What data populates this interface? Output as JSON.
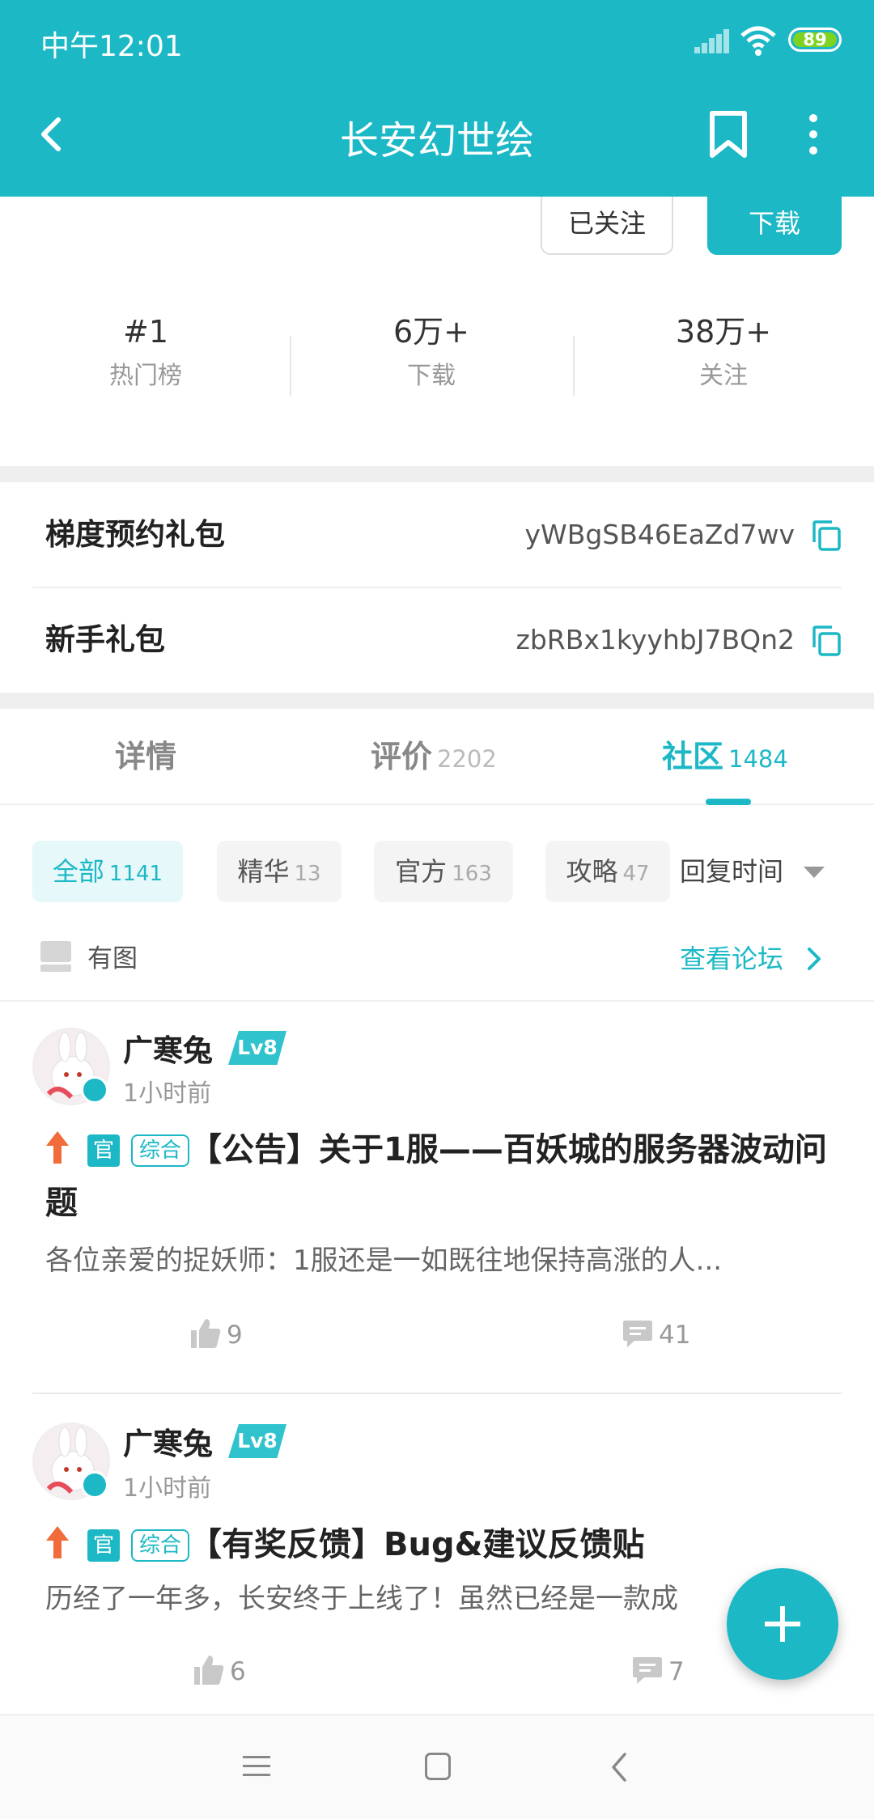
{
  "status_bar": {
    "time": "中午12:01",
    "battery": "89"
  },
  "nav": {
    "title": "长安幻世绘"
  },
  "actions": {
    "follow_label": "已关注",
    "download_label": "下载"
  },
  "stats": [
    {
      "value": "#1",
      "label": "热门榜"
    },
    {
      "value": "6万+",
      "label": "下载"
    },
    {
      "value": "38万+",
      "label": "关注"
    }
  ],
  "gifts": [
    {
      "name": "梯度预约礼包",
      "code": "yWBgSB46EaZd7wv"
    },
    {
      "name": "新手礼包",
      "code": "zbRBx1kyyhbJ7BQn2"
    }
  ],
  "tabs": [
    {
      "label": "详情",
      "count": ""
    },
    {
      "label": "评价",
      "count": "2202"
    },
    {
      "label": "社区",
      "count": "1484"
    }
  ],
  "filters": [
    {
      "label": "全部",
      "count": "1141"
    },
    {
      "label": "精华",
      "count": "13"
    },
    {
      "label": "官方",
      "count": "163"
    },
    {
      "label": "攻略",
      "count": "47"
    }
  ],
  "sort_label": "回复时间",
  "has_image_label": "有图",
  "forum_link": "查看论坛",
  "posts": [
    {
      "author": "广寒兔",
      "level": "Lv8",
      "time": "1小时前",
      "official_tag": "官",
      "category_tag": "综合",
      "title": "【公告】关于1服——百妖城的服务器波动问题",
      "excerpt": "各位亲爱的捉妖师：1服还是一如既往地保持高涨的人...",
      "likes": "9",
      "comments": "41"
    },
    {
      "author": "广寒兔",
      "level": "Lv8",
      "time": "1小时前",
      "official_tag": "官",
      "category_tag": "综合",
      "title": "【有奖反馈】Bug&建议反馈贴",
      "excerpt": "历经了一年多，长安终于上线了！虽然已经是一款成",
      "likes": "6",
      "comments": "7"
    }
  ],
  "colors": {
    "accent": "#1CB8C6",
    "arrow": "#F26B3A",
    "battery": "#7ED321"
  }
}
